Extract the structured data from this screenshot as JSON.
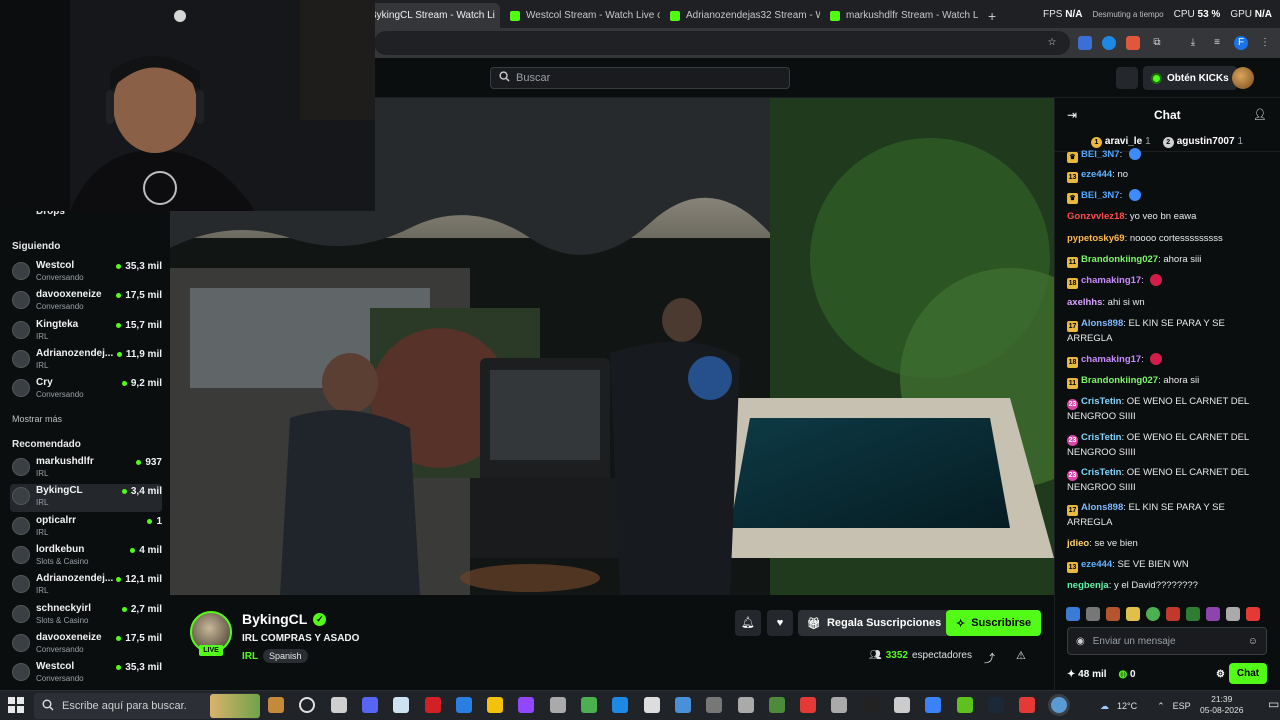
{
  "browser": {
    "tabs": [
      {
        "title": "BykingCL Stream - Watch Li",
        "active": true
      },
      {
        "title": "Westcol Stream - Watch Live o",
        "active": false
      },
      {
        "title": "Adrianozendejas32 Stream - W",
        "active": false
      },
      {
        "title": "markushdlfr Stream - Watch Li",
        "active": false
      }
    ],
    "new_tab_label": "+",
    "stats": {
      "fps_label": "FPS",
      "fps_value": "N/A",
      "cpu_label": "CPU",
      "cpu_value": "53 %",
      "gpu_label": "GPU",
      "gpu_value": "N/A",
      "overlay_note": "Desmuting a tiempo"
    }
  },
  "header": {
    "search_placeholder": "Buscar",
    "kicks_button": "Obtén KICKs"
  },
  "sidebar": {
    "drops_label": "Drops",
    "following_title": "Siguiendo",
    "following": [
      {
        "name": "Westcol",
        "category": "Conversando",
        "viewers": "35,3 mil"
      },
      {
        "name": "davooxeneize",
        "category": "Conversando",
        "viewers": "17,5 mil"
      },
      {
        "name": "Kingteka",
        "category": "IRL",
        "viewers": "15,7 mil"
      },
      {
        "name": "Adrianozendej...",
        "category": "IRL",
        "viewers": "11,9 mil"
      },
      {
        "name": "Cry",
        "category": "Conversando",
        "viewers": "9,2 mil"
      }
    ],
    "show_more": "Mostrar más",
    "recommended_title": "Recomendado",
    "recommended": [
      {
        "name": "markushdlfr",
        "category": "IRL",
        "viewers": "937"
      },
      {
        "name": "BykingCL",
        "category": "IRL",
        "viewers": "3,4 mil"
      },
      {
        "name": "opticalrr",
        "category": "IRL",
        "viewers": "1"
      },
      {
        "name": "lordkebun",
        "category": "Slots & Casino",
        "viewers": "4 mil"
      },
      {
        "name": "Adrianozendej...",
        "category": "IRL",
        "viewers": "12,1 mil"
      },
      {
        "name": "schneckyirl",
        "category": "Slots & Casino",
        "viewers": "2,7 mil"
      },
      {
        "name": "davooxeneize",
        "category": "Conversando",
        "viewers": "17,5 mil"
      },
      {
        "name": "Westcol",
        "category": "Conversando",
        "viewers": "35,3 mil"
      }
    ]
  },
  "stream": {
    "live_label": "LIVE",
    "channel_name": "BykingCL",
    "title": "IRL COMPRAS Y ASADO",
    "category": "IRL",
    "tag": "Spanish",
    "gift_label": "Regala Suscripciones",
    "subscribe_label": "Suscribirse",
    "viewer_count": "3352",
    "viewer_label": "espectadores"
  },
  "chat": {
    "title": "Chat",
    "pinned": [
      {
        "rank": "1",
        "name": "aravi_le",
        "count": "1"
      },
      {
        "rank": "2",
        "name": "agustin7007",
        "count": "1"
      }
    ],
    "messages": [
      {
        "badge": "",
        "user": "BEI_3N7",
        "color": "#53a7ff",
        "text": ""
      },
      {
        "badge": "13",
        "user": "eze444",
        "color": "#5fb3ff",
        "text": "no"
      },
      {
        "badge": "",
        "user": "BEI_3N7",
        "color": "#53a7ff",
        "text": ""
      },
      {
        "badge": "",
        "user": "Gonzvvlez18",
        "color": "#ff4d4d",
        "text": "yo veo bn eawa"
      },
      {
        "badge": "",
        "user": "pypetosky69",
        "color": "#ffb84d",
        "text": "noooo cortesssssssss"
      },
      {
        "badge": "11",
        "user": "Brandonkiing027",
        "color": "#7cf56a",
        "text": "ahora siii"
      },
      {
        "badge": "18",
        "user": "chamaking17",
        "color": "#c88cff",
        "text": ""
      },
      {
        "badge": "",
        "user": "axelhhs",
        "color": "#d8a3ff",
        "text": "ahi si wn"
      },
      {
        "badge": "17",
        "user": "Alons898",
        "color": "#7fb8ff",
        "text": "EL KIN SE PARA Y SE ARREGLA"
      },
      {
        "badge": "18",
        "user": "chamaking17",
        "color": "#c88cff",
        "text": ""
      },
      {
        "badge": "11",
        "user": "Brandonkiing027",
        "color": "#7cf56a",
        "text": "ahora sii"
      },
      {
        "badge": "23",
        "user": "CrisTetin",
        "color": "#7fd6ff",
        "text": "OE WENO EL CARNET DEL NENGROO SIIII"
      },
      {
        "badge": "23",
        "user": "CrisTetin",
        "color": "#7fd6ff",
        "text": "OE WENO EL CARNET DEL NENGROO SIIII"
      },
      {
        "badge": "23",
        "user": "CrisTetin",
        "color": "#7fd6ff",
        "text": "OE WENO EL CARNET DEL NENGROO SIIII"
      },
      {
        "badge": "17",
        "user": "Alons898",
        "color": "#7fb8ff",
        "text": "EL KIN SE PARA Y SE ARREGLA"
      },
      {
        "badge": "",
        "user": "jdieo",
        "color": "#ffd36b",
        "text": "se ve bien"
      },
      {
        "badge": "13",
        "user": "eze444",
        "color": "#5fb3ff",
        "text": "SE VE BIEN WN"
      },
      {
        "badge": "",
        "user": "negbenja",
        "color": "#5ef2a6",
        "text": "y el David????????"
      }
    ],
    "input_placeholder": "Enviar un mensaje",
    "kicks_count": "48 mil",
    "points": "0",
    "send_label": "Chat"
  },
  "taskbar": {
    "search_placeholder": "Escribe aquí para buscar.",
    "temperature": "12°C",
    "language": "ESP",
    "time": "21:39",
    "date": "05-08-2026"
  },
  "colors": {
    "accent": "#53fc18",
    "background": "#0b0e0f"
  }
}
